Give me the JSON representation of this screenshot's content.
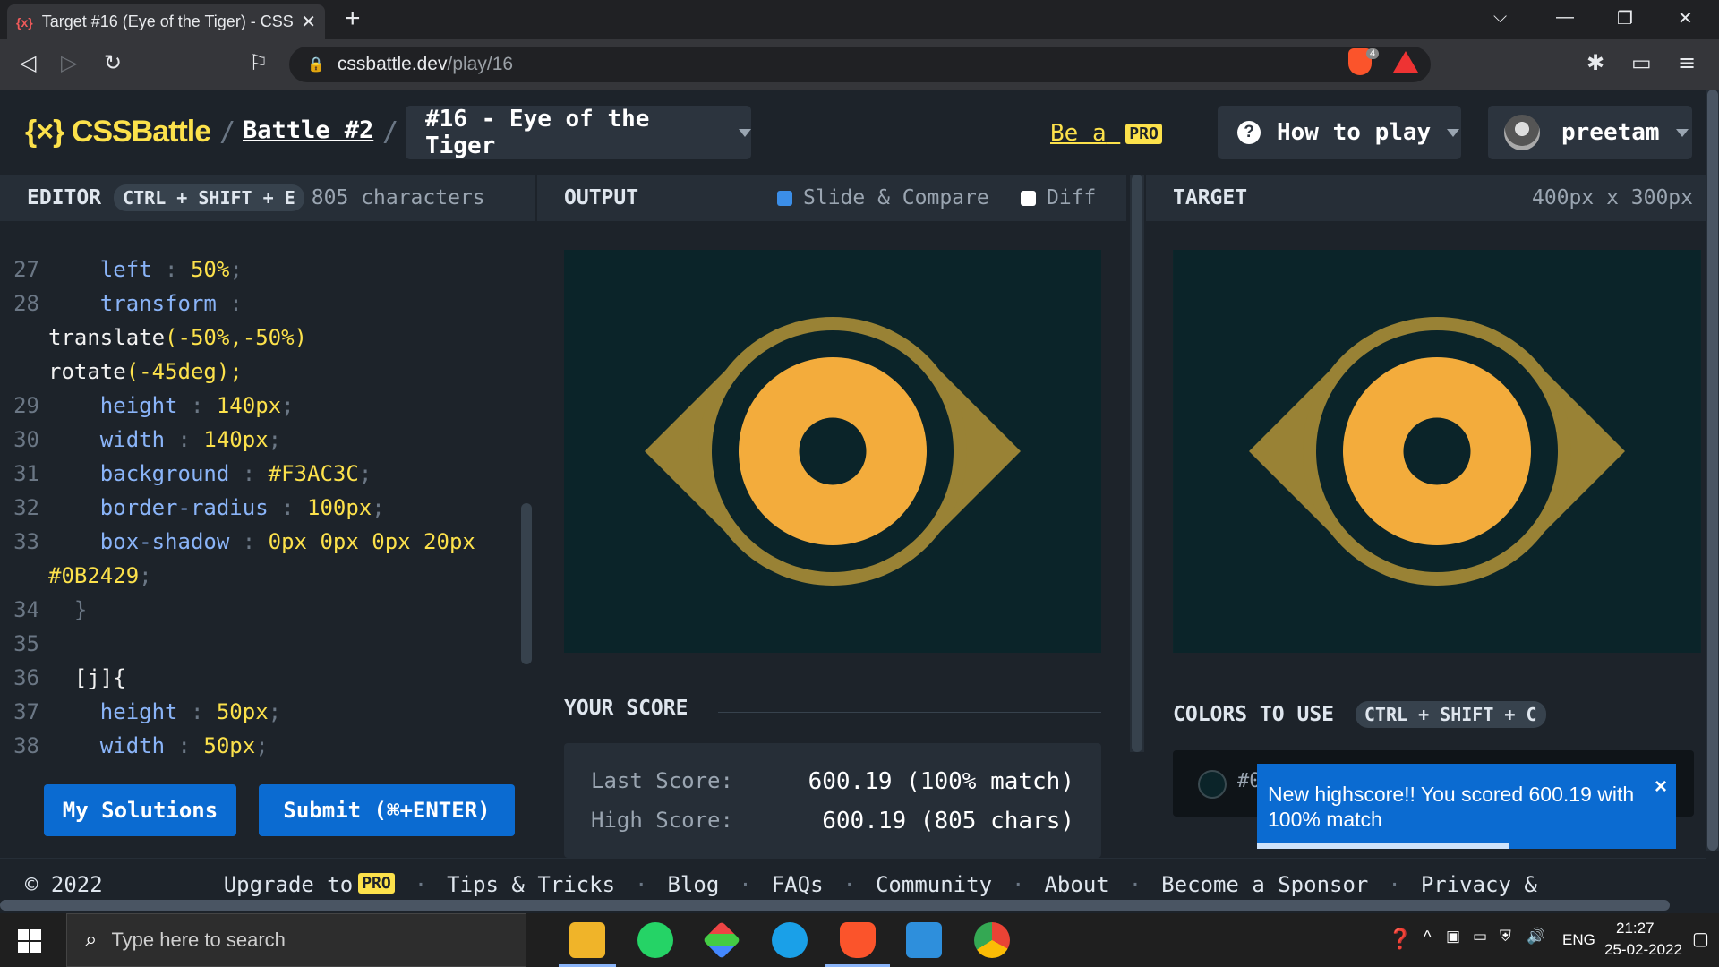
{
  "browser": {
    "tab_title": "Target #16 (Eye of the Tiger) - CSS",
    "tab_favicon": "{x}",
    "url_host": "cssbattle.dev",
    "url_path": "/play/16",
    "brave_badge": "4"
  },
  "header": {
    "logo": "{×} CSSBattle",
    "battle": "Battle #2",
    "target_select": "#16 - Eye of the Tiger",
    "be_a": "Be a",
    "pro": "PRO",
    "how_to_play": "How to play",
    "username": "preetam"
  },
  "editor": {
    "title": "EDITOR",
    "shortcut": "CTRL + SHIFT + E",
    "char_count": "805 characters",
    "lines": [
      {
        "n": "27",
        "prop": "left",
        "val": "50%"
      },
      {
        "n": "28",
        "prop": "transform",
        "val": ""
      },
      {
        "n": "",
        "raw1": "translate",
        "raw2": "(-50%,-50%)"
      },
      {
        "n": "",
        "raw1": "rotate",
        "raw2": "(-45deg);"
      },
      {
        "n": "29",
        "prop": "height",
        "val": "140px"
      },
      {
        "n": "30",
        "prop": "width",
        "val": "140px"
      },
      {
        "n": "31",
        "prop": "background",
        "val": "#F3AC3C"
      },
      {
        "n": "32",
        "prop": "border-radius",
        "val": "100px"
      },
      {
        "n": "33",
        "prop": "box-shadow",
        "val": "0px 0px 0px 20px"
      },
      {
        "n": "",
        "raw1": "#0B2429",
        "raw2": ";"
      },
      {
        "n": "34",
        "brace": "}"
      },
      {
        "n": "35"
      },
      {
        "n": "36",
        "sel": "[j]{"
      },
      {
        "n": "37",
        "prop": "height",
        "val": "50px"
      },
      {
        "n": "38",
        "prop": "width",
        "val": "50px"
      }
    ],
    "my_solutions": "My Solutions",
    "submit": "Submit (⌘+ENTER)"
  },
  "output": {
    "title": "OUTPUT",
    "slide_compare": "Slide & Compare",
    "slide_checked": true,
    "diff": "Diff",
    "diff_checked": false
  },
  "target": {
    "title": "TARGET",
    "dimensions": "400px x 300px"
  },
  "artwork": {
    "bg": "#0B2429",
    "eye": "#998235",
    "iris": "#F3AC3C"
  },
  "score": {
    "title": "YOUR SCORE",
    "last_label": "Last Score:",
    "last_value": "600.19 (100% match)",
    "high_label": "High Score:",
    "high_value": "600.19 (805 chars)"
  },
  "colors": {
    "title": "COLORS TO USE",
    "shortcut": "CTRL + SHIFT + C",
    "first_hex": "#0"
  },
  "toast": {
    "message": "New highscore!! You scored 600.19 with 100% match",
    "close": "×",
    "progress": 0.6
  },
  "footer": {
    "copyright": "© 2022",
    "upgrade": "Upgrade to",
    "pro": "PRO",
    "links": [
      "Tips & Tricks",
      "Blog",
      "FAQs",
      "Community",
      "About",
      "Become a Sponsor",
      "Privacy &"
    ]
  },
  "taskbar": {
    "search_placeholder": "Type here to search",
    "lang": "ENG",
    "time": "21:27",
    "date": "25-02-2022"
  }
}
